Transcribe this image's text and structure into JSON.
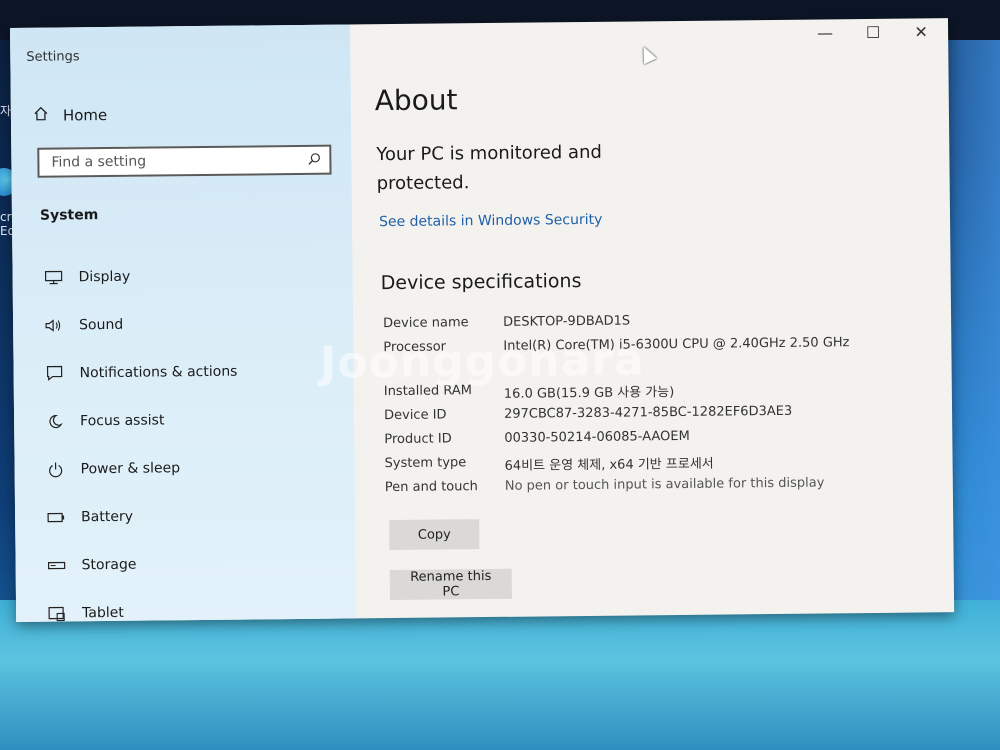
{
  "desktop": {
    "icon_a_text": "자ㄴ",
    "icon_b_text": "cros\nEdge"
  },
  "window": {
    "app_title": "Settings",
    "controls": {
      "minimize": "—",
      "maximize": "☐",
      "close": "✕"
    }
  },
  "sidebar": {
    "home_label": "Home",
    "search": {
      "placeholder": "Find a setting",
      "value": ""
    },
    "section_label": "System",
    "items": [
      {
        "label": "Display",
        "icon": "display-icon"
      },
      {
        "label": "Sound",
        "icon": "sound-icon"
      },
      {
        "label": "Notifications & actions",
        "icon": "notifications-icon"
      },
      {
        "label": "Focus assist",
        "icon": "focus-assist-icon"
      },
      {
        "label": "Power & sleep",
        "icon": "power-icon"
      },
      {
        "label": "Battery",
        "icon": "battery-icon"
      },
      {
        "label": "Storage",
        "icon": "storage-icon"
      },
      {
        "label": "Tablet",
        "icon": "tablet-icon"
      }
    ]
  },
  "main": {
    "title": "About",
    "protection_text": "Your PC is monitored and protected.",
    "security_link": "See details in Windows Security",
    "specs_heading": "Device specifications",
    "specs": [
      {
        "key": "Device name",
        "value": "DESKTOP-9DBAD1S"
      },
      {
        "key": "Processor",
        "value": "Intel(R) Core(TM) i5-6300U CPU @ 2.40GHz   2.50 GHz"
      },
      {
        "key": "Installed RAM",
        "value": "16.0 GB(15.9 GB 사용 가능)"
      },
      {
        "key": "Device ID",
        "value": "297CBC87-3283-4271-85BC-1282EF6D3AE3"
      },
      {
        "key": "Product ID",
        "value": "00330-50214-06085-AAOEM"
      },
      {
        "key": "System type",
        "value": "64비트 운영 체제, x64 기반 프로세서"
      },
      {
        "key": "Pen and touch",
        "value": "No pen or touch input is available for this display"
      }
    ],
    "copy_button": "Copy",
    "rename_button": "Rename this PC"
  },
  "watermark": "Joonggonara"
}
